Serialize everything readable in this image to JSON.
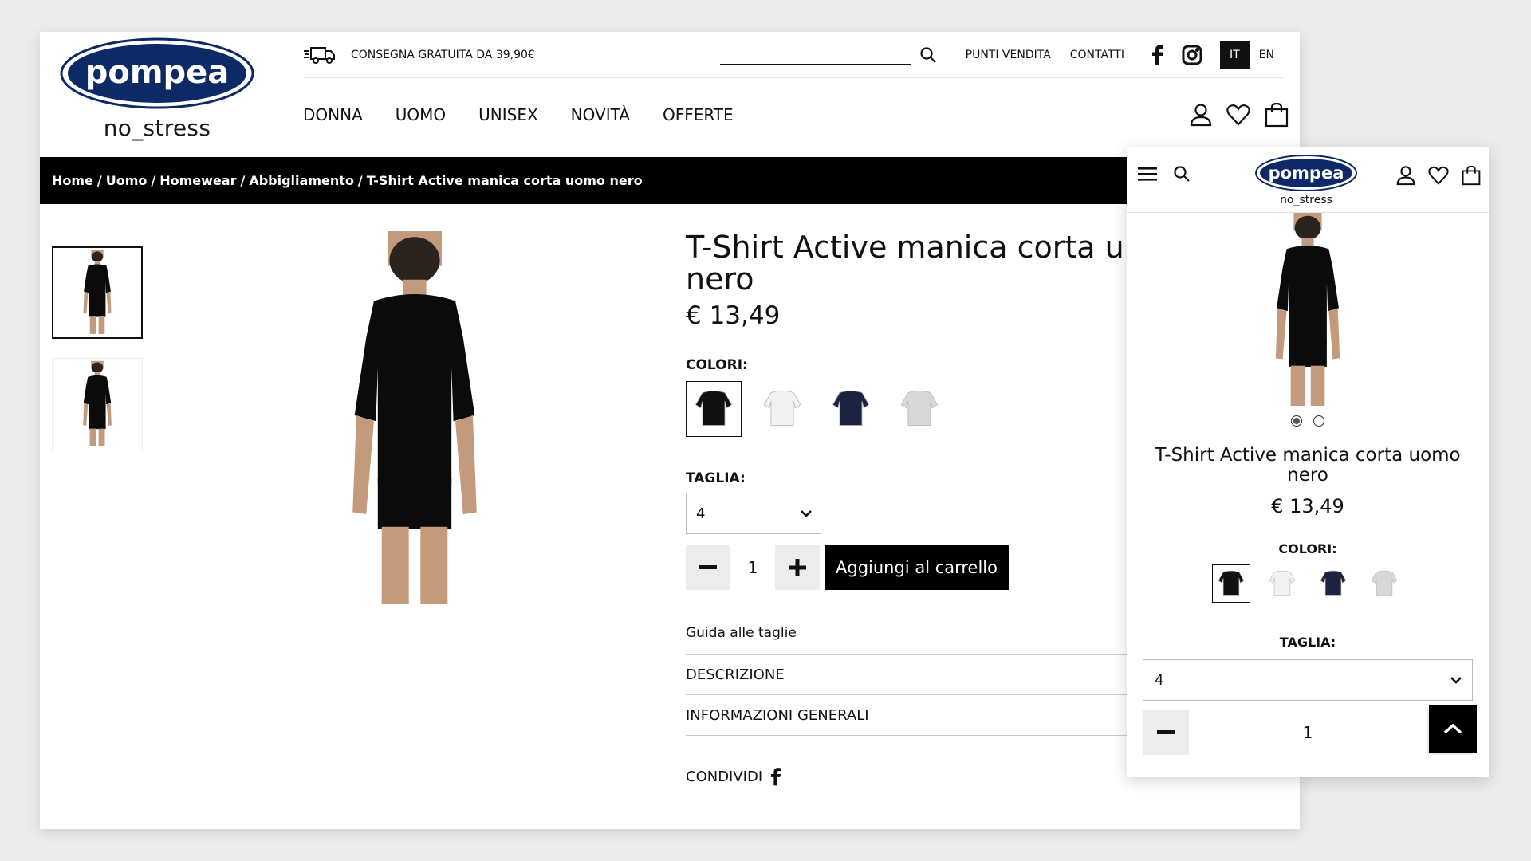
{
  "brand": {
    "name": "pompea",
    "tagline": "no_stress",
    "color": "#0e2a66"
  },
  "topbar": {
    "shipping": "CONSEGNA GRATUITA DA 39,90€",
    "links": [
      "PUNTI VENDITA",
      "CONTATTI"
    ],
    "languages": [
      "IT",
      "EN"
    ],
    "active_language": "IT"
  },
  "nav": [
    "DONNA",
    "UOMO",
    "UNISEX",
    "NOVITÀ",
    "OFFERTE"
  ],
  "breadcrumb": [
    "Home",
    "/",
    "Uomo",
    "/",
    "Homewear",
    "/",
    "Abbigliamento",
    "/",
    "T-Shirt Active manica corta uomo nero"
  ],
  "product": {
    "title": "T-Shirt Active manica corta uomo nero",
    "title_shown": "T-Shirt Active manica corta u",
    "title_line2": "nero",
    "price": "€ 13,49",
    "colors_label": "COLORI:",
    "colors": [
      "#111111",
      "#f2f2f2",
      "#1b2340",
      "#d8d8d8"
    ],
    "selected_color": 0,
    "size_label": "TAGLIA:",
    "size_value": "4",
    "quantity": "1",
    "add_to_cart": "Aggiungi al carrello",
    "size_guide": "Guida alle taglie",
    "sections": [
      "DESCRIZIONE",
      "INFORMAZIONI GENERALI"
    ],
    "share": "CONDIVIDI",
    "images": 2,
    "current_image": 0
  },
  "mobile": {
    "title": "T-Shirt Active manica corta uomo nero",
    "price": "€ 13,49",
    "colors_label": "COLORI:",
    "size_label": "TAGLIA:",
    "size_value": "4",
    "quantity": "1"
  },
  "icons": [
    "truck-icon",
    "search-icon",
    "facebook-icon",
    "instagram-icon",
    "user-icon",
    "heart-icon",
    "bag-icon",
    "menu-icon",
    "chevron-down-icon",
    "minus-icon",
    "plus-icon",
    "arrow-up-icon"
  ]
}
